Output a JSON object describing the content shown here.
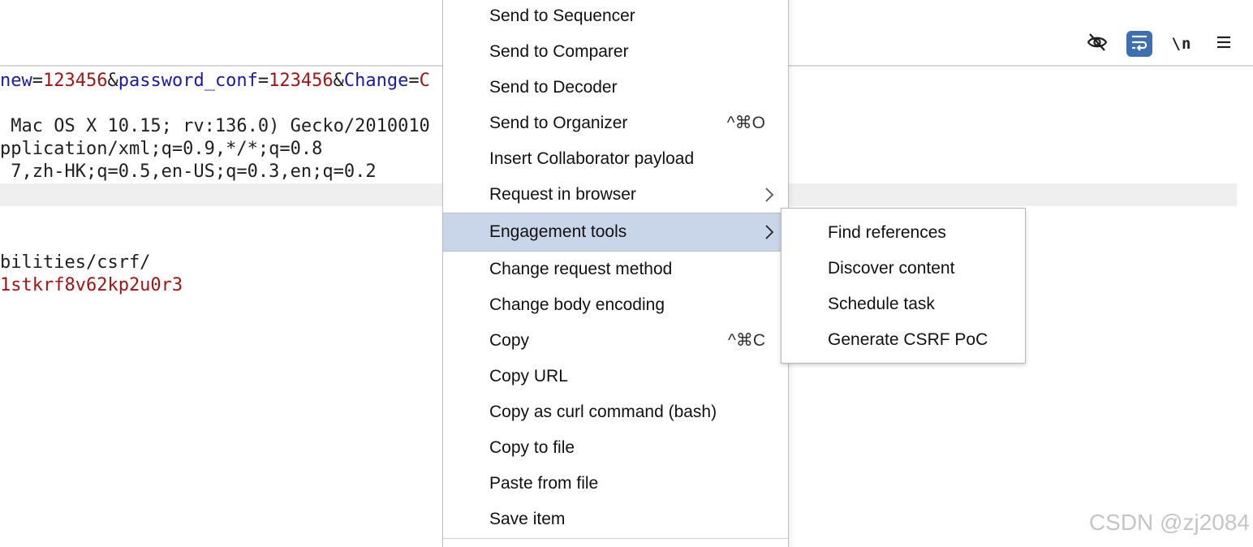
{
  "toolbar": {
    "icons": [
      "eye-off-icon",
      "wrap-lines-icon",
      "newline-icon",
      "hamburger-menu-icon"
    ],
    "newline_label": "\\n",
    "active_color": "#3d6fb1"
  },
  "editor": {
    "line1": {
      "p1_name": "new",
      "eq1": "=",
      "p1_value": "123456",
      "amp1": "&",
      "p2_name": "password_conf",
      "eq2": "=",
      "p2_value": "123456",
      "amp2": "&",
      "p3_name": "Change",
      "eq3": "=",
      "p3_value": "C"
    },
    "line_user_agent": " Mac OS X 10.15; rv:136.0) Gecko/2010010",
    "line_accept": "pplication/xml;q=0.9,*/*;q=0.8",
    "line_accept_language": " 7,zh-HK;q=0.5,en-US;q=0.3,en;q=0.2",
    "line_referer": "bilities/csrf/",
    "line_cookie": "1stkrf8v62kp2u0r3",
    "colors": {
      "param_name": "#1a1aa6",
      "param_value": "#a31515",
      "line_highlight": "#efefef"
    }
  },
  "context_menu": {
    "items": [
      {
        "label": "Send to Sequencer",
        "shortcut": ""
      },
      {
        "label": "Send to Comparer",
        "shortcut": ""
      },
      {
        "label": "Send to Decoder",
        "shortcut": ""
      },
      {
        "label": "Send to Organizer",
        "shortcut": "^⌘O"
      },
      {
        "label": "Insert Collaborator payload",
        "shortcut": ""
      },
      {
        "label": "Request in browser",
        "shortcut": ""
      },
      {
        "label": "Engagement tools",
        "shortcut": ""
      },
      {
        "label": "Change request method",
        "shortcut": ""
      },
      {
        "label": "Change body encoding",
        "shortcut": ""
      },
      {
        "label": "Copy",
        "shortcut": "^⌘C"
      },
      {
        "label": "Copy URL",
        "shortcut": ""
      },
      {
        "label": "Copy as curl command (bash)",
        "shortcut": ""
      },
      {
        "label": "Copy to file",
        "shortcut": ""
      },
      {
        "label": "Paste from file",
        "shortcut": ""
      },
      {
        "label": "Save item",
        "shortcut": ""
      }
    ],
    "selected_label": "Engagement tools",
    "selected_color": "#c9d6ea"
  },
  "submenu": {
    "items": [
      {
        "label": "Find references"
      },
      {
        "label": "Discover content"
      },
      {
        "label": "Schedule task"
      },
      {
        "label": "Generate CSRF PoC"
      }
    ]
  },
  "watermark": "CSDN @zj2084"
}
